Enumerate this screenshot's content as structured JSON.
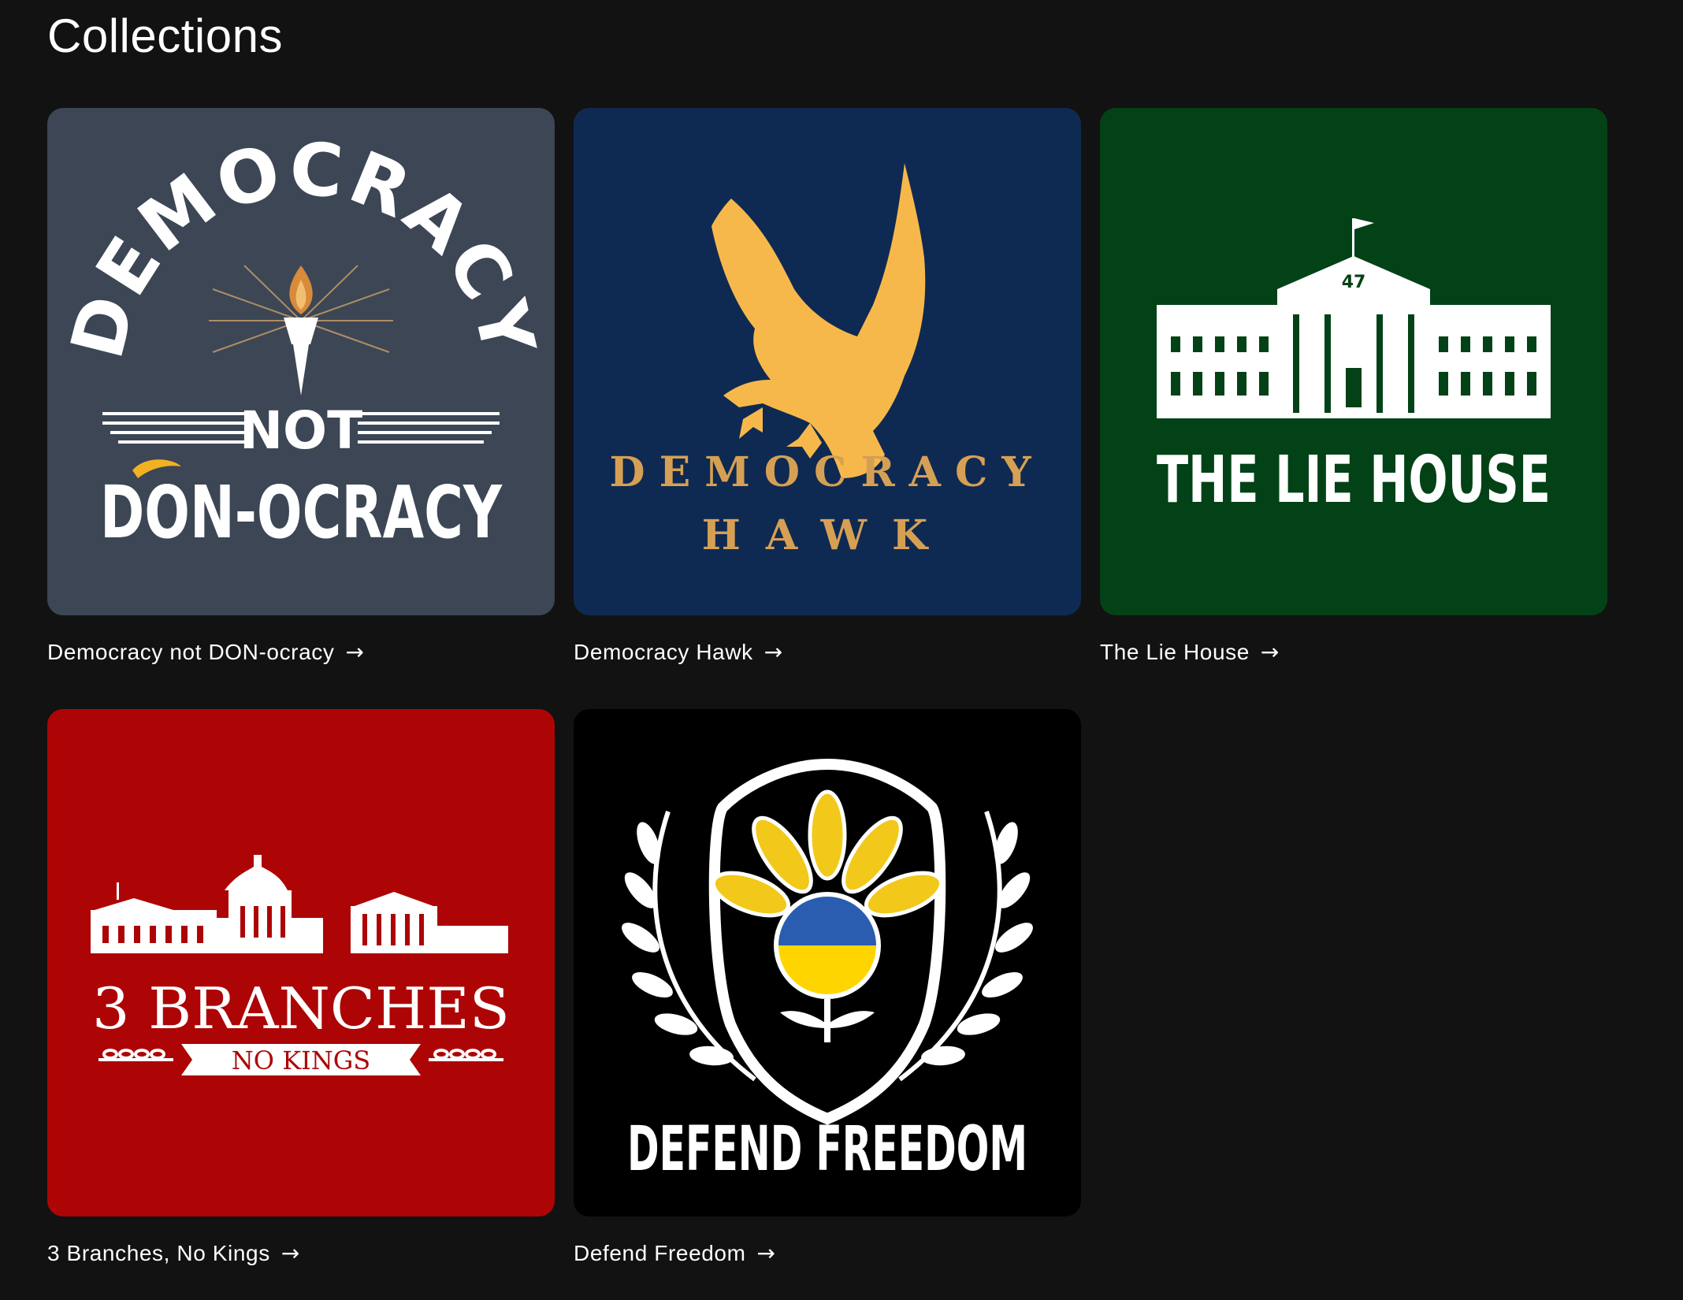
{
  "page": {
    "title": "Collections"
  },
  "collections": [
    {
      "name": "Democracy not DON-ocracy",
      "arrow": "→",
      "bg": "#3c4655",
      "art": {
        "arc": "DEMOCRACY",
        "middle": "NOT",
        "bottom": "DON-OCRACY"
      }
    },
    {
      "name": "Democracy Hawk",
      "arrow": "→",
      "bg": "#0f2a52",
      "art": {
        "line1": "DEMOCRACY",
        "line2": "HAWK",
        "accent": "#f7b84b"
      }
    },
    {
      "name": "The Lie House",
      "arrow": "→",
      "bg": "#034216",
      "art": {
        "badge": "47",
        "text_a": "THE ",
        "text_b": "LIE",
        "text_c": " HOUSE"
      }
    },
    {
      "name": "3 Branches, No Kings",
      "arrow": "→",
      "bg": "#ad0506",
      "art": {
        "line1": "3 BRANCHES",
        "banner": "NO KINGS"
      }
    },
    {
      "name": "Defend Freedom",
      "arrow": "→",
      "bg": "#000000",
      "art": {
        "line1": "DEFEND FREEDOM",
        "blue": "#2a5db0",
        "yellow": "#ffd500",
        "petal": "#f2c81a"
      }
    }
  ]
}
